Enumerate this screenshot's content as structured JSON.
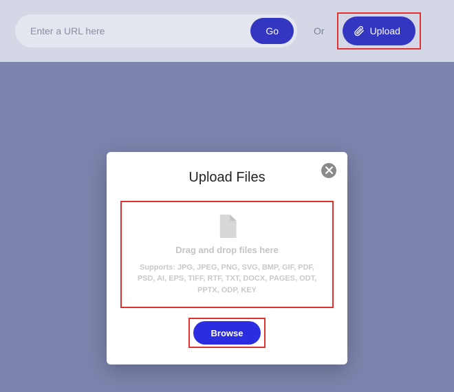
{
  "topbar": {
    "url_placeholder": "Enter a URL here",
    "go_label": "Go",
    "or_label": "Or",
    "upload_label": "Upload"
  },
  "modal": {
    "title": "Upload Files",
    "drag_text": "Drag and drop files here",
    "supports_text": "Supports: JPG, JPEG, PNG, SVG, BMP, GIF, PDF, PSD, AI, EPS, TIFF, RTF, TXT, DOCX, PAGES, ODT, PPTX, ODP, KEY",
    "browse_label": "Browse"
  }
}
